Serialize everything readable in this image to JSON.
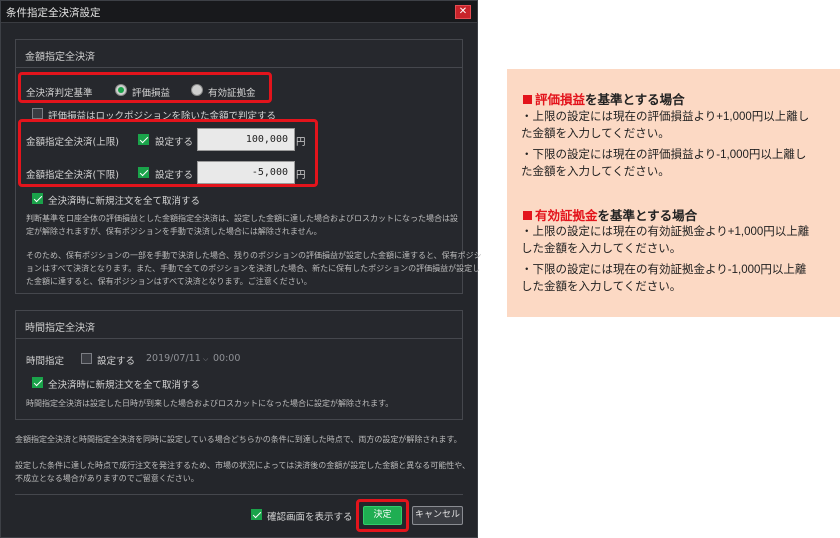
{
  "dialog": {
    "title": "条件指定全決済設定",
    "close_glyph": "✕"
  },
  "amount_section": {
    "title": "金額指定全決済",
    "criteria_label": "全決済判定基準",
    "options": [
      "評価損益",
      "有効証拠金"
    ],
    "selected": "評価損益",
    "exclude_lock_label": "評価損益はロックポジションを除いた金額で判定する",
    "exclude_lock_checked": false,
    "upper": {
      "label": "金額指定全決済(上限)",
      "checkbox_label": "設定する",
      "checked": true,
      "value": "100,000",
      "unit": "円"
    },
    "lower": {
      "label": "金額指定全決済(下限)",
      "checkbox_label": "設定する",
      "checked": true,
      "value": "-5,000",
      "unit": "円"
    },
    "cancel_new_label": "全決済時に新規注文を全て取消する",
    "cancel_new_checked": true,
    "note_lines": [
      "判断基準を口座全体の評価損益とした金額指定全決済は、設定した金額に達した場合およびロスカットになった場合は設",
      "定が解除されますが、保有ポジションを手動で決済した場合には解除されません。",
      "",
      "そのため、保有ポジションの一部を手動で決済した場合、残りのポジションの評価損益が設定した金額に達すると、保有ポジシ",
      "ョンはすべて決済となります。また、手動で全てのポジションを決済した場合、新たに保有したポジションの評価損益が設定し",
      "た金額に達すると、保有ポジションはすべて決済となります。ご注意ください。"
    ]
  },
  "time_section": {
    "title": "時間指定全決済",
    "time_label": "時間指定",
    "checkbox_label": "設定する",
    "checked": false,
    "date": "2019/07/11",
    "time": "00:00",
    "cancel_new_label": "全決済時に新規注文を全て取消する",
    "cancel_new_checked": true,
    "note": "時間指定全決済は設定した日時が到来した場合およびロスカットになった場合に設定が解除されます。"
  },
  "footer": {
    "note1": "金額指定全決済と時間指定全決済を同時に設定している場合どちらかの条件に到達した時点で、両方の設定が解除されます。",
    "note2_lines": [
      "設定した条件に達した時点で成行注文を発注するため、市場の状況によっては決済後の金額が設定した金額と異なる可能性や、",
      "不成立となる場合がありますのでご留意ください。"
    ],
    "confirm_label": "確認画面を表示する",
    "confirm_checked": true,
    "ok_label": "決定",
    "cancel_label": "キャンセル"
  },
  "guide": {
    "sections": [
      {
        "marker": "■",
        "keyword": "評価損益",
        "suffix": "を基準とする場合",
        "lines": [
          "・上限の設定には現在の評価損益より+1,000円以上離し",
          "た金額を入力してください。",
          "・下限の設定には現在の評価損益より-1,000円以上離し",
          "た金額を入力してください。"
        ]
      },
      {
        "marker": "■",
        "keyword": "有効証拠金",
        "suffix": "を基準とする場合",
        "lines": [
          "・上限の設定には現在の有効証拠金より+1,000円以上離",
          "した金額を入力してください。",
          "・下限の設定には現在の有効証拠金より-1,000円以上離",
          "した金額を入力してください。"
        ]
      }
    ]
  },
  "colors": {
    "highlight_frame": "#e3141c",
    "accent_green": "#1aa34a",
    "dialog_bg": "#24262b",
    "guide_bg": "#fcd9c4"
  }
}
